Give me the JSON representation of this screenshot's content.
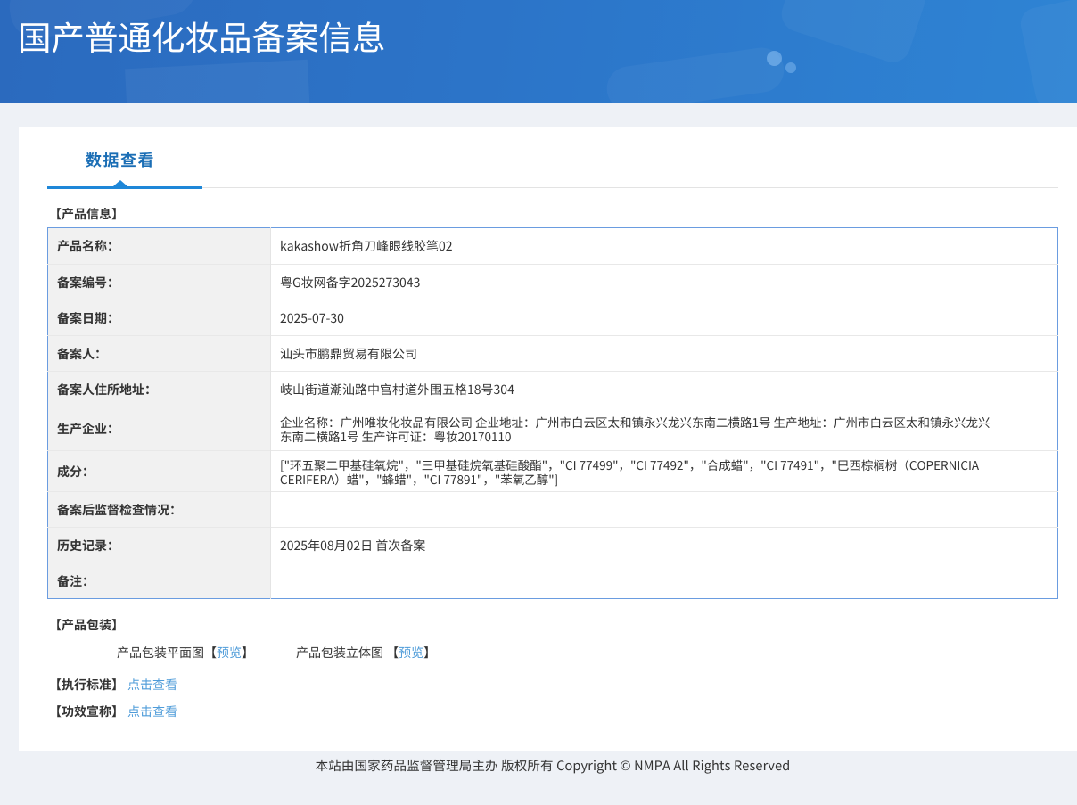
{
  "header": {
    "title": "国产普通化妆品备案信息"
  },
  "tabs": [
    {
      "label": "数据查看"
    }
  ],
  "product_info": {
    "section_title": "【产品信息】",
    "rows": [
      {
        "label": "产品名称：",
        "value": "kakashow折角刀峰眼线胶笔02"
      },
      {
        "label": "备案编号：",
        "value": "粤G妆网备字2025273043"
      },
      {
        "label": "备案日期：",
        "value": "2025-07-30"
      },
      {
        "label": "备案人：",
        "value": "汕头市鹏鼎贸易有限公司"
      },
      {
        "label": "备案人住所地址：",
        "value": "岐山街道潮汕路中宫村道外围五格18号304"
      },
      {
        "label": "生产企业：",
        "value": "企业名称：广州唯妆化妆品有限公司 企业地址：广州市白云区太和镇永兴龙兴东南二横路1号 生产地址：广州市白云区太和镇永兴龙兴东南二横路1号 生产许可证：粤妆20170110"
      },
      {
        "label": "成分：",
        "value": "[\"环五聚二甲基硅氧烷\"，\"三甲基硅烷氧基硅酸酯\"，\"CI 77499\"，\"CI 77492\"，\"合成蜡\"，\"CI 77491\"，\"巴西棕榈树（COPERNICIA CERIFERA）蜡\"，\"蜂蜡\"，\"CI 77891\"，\"苯氧乙醇\"]"
      },
      {
        "label": "备案后监督检查情况：",
        "value": ""
      },
      {
        "label": "历史记录：",
        "value": "2025年08月02日 首次备案"
      },
      {
        "label": "备注：",
        "value": ""
      }
    ]
  },
  "packaging": {
    "section_title": "【产品包装】",
    "items": [
      {
        "label": "产品包装平面图",
        "bracket_open": "【",
        "link_label": "预览",
        "bracket_close": "】"
      },
      {
        "label": "产品包装立体图 ",
        "bracket_open": "【",
        "link_label": "预览",
        "bracket_close": "】"
      }
    ]
  },
  "standard": {
    "section_title": "【执行标准】",
    "link_label": "点击查看"
  },
  "efficacy": {
    "section_title": "【功效宣称】",
    "link_label": "点击查看"
  },
  "footer": {
    "text": "本站由国家药品监督管理局主办 版权所有 Copyright © NMPA All Rights Reserved"
  },
  "colors": {
    "accent_blue": "#1b6eb5",
    "underline_blue": "#1e87d8",
    "table_border_blue": "#6a9ce0",
    "link_blue": "#4f9cd9",
    "header_gradient_start": "#2b6ac0",
    "header_gradient_end": "#2f8ad9"
  }
}
